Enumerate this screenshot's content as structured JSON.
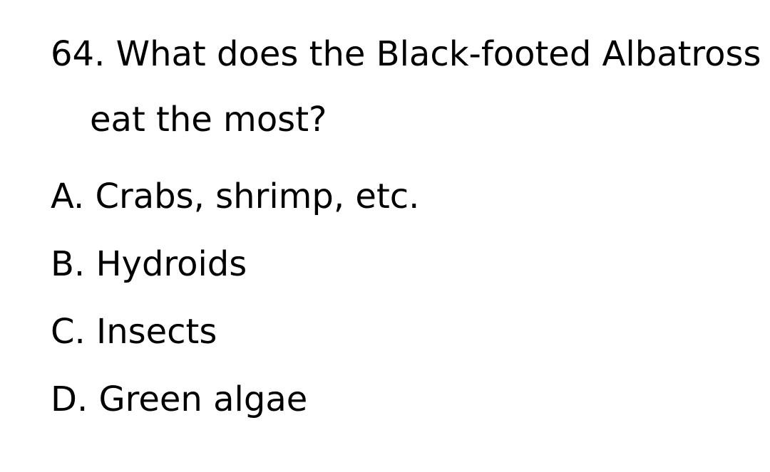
{
  "question": {
    "number": "64.",
    "line1": "What does the Black-footed Albatross",
    "line2": "eat the most?"
  },
  "options": [
    {
      "letter": "A.",
      "text": "Crabs, shrimp, etc."
    },
    {
      "letter": "B.",
      "text": "Hydroids"
    },
    {
      "letter": "C.",
      "text": "Insects"
    },
    {
      "letter": "D.",
      "text": "Green algae"
    }
  ]
}
